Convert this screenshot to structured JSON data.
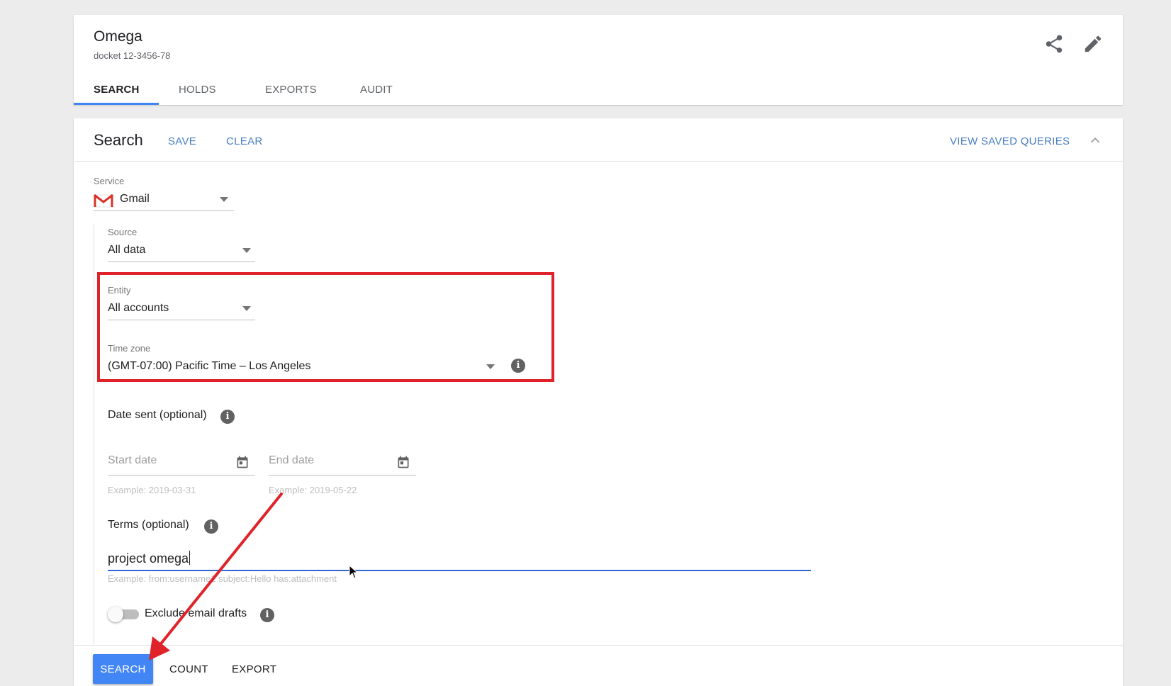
{
  "header": {
    "title": "Omega",
    "subtitle": "docket 12-3456-78",
    "share_icon": "share-icon",
    "edit_icon": "pencil-icon"
  },
  "tabs": [
    {
      "label": "SEARCH",
      "active": true
    },
    {
      "label": "HOLDS",
      "active": false
    },
    {
      "label": "EXPORTS",
      "active": false
    },
    {
      "label": "AUDIT",
      "active": false
    }
  ],
  "search_panel": {
    "title": "Search",
    "save_label": "SAVE",
    "clear_label": "CLEAR",
    "view_saved_label": "VIEW SAVED QUERIES",
    "collapse_icon": "chevron-up-icon"
  },
  "form": {
    "service": {
      "label": "Service",
      "value": "Gmail",
      "icon": "gmail-icon"
    },
    "source": {
      "label": "Source",
      "value": "All data"
    },
    "entity": {
      "label": "Entity",
      "value": "All accounts"
    },
    "timezone": {
      "label": "Time zone",
      "value": "(GMT-07:00) Pacific Time – Los Angeles"
    },
    "date_sent": {
      "label": "Date sent (optional)",
      "start_placeholder": "Start date",
      "start_hint": "Example: 2019-03-31",
      "end_placeholder": "End date",
      "end_hint": "Example: 2019-05-22"
    },
    "terms": {
      "label": "Terms (optional)",
      "value": "project omega",
      "hint": "Example: from:username1 subject:Hello has:attachment"
    },
    "exclude_drafts": {
      "label": "Exclude email drafts",
      "enabled": false
    }
  },
  "footer": {
    "search_label": "SEARCH",
    "count_label": "COUNT",
    "export_label": "EXPORT"
  },
  "colors": {
    "accent": "#4285f4",
    "link": "#4a7fc1",
    "annotation": "#e0232a"
  }
}
